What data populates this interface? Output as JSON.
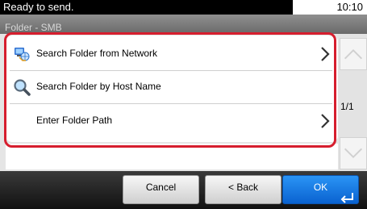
{
  "status": {
    "message": "Ready to send.",
    "time": "10:10"
  },
  "screen": {
    "title": "Folder - SMB"
  },
  "menu": {
    "items": [
      {
        "label": "Search Folder from Network",
        "icon": "network-folder-icon",
        "has_arrow": true
      },
      {
        "label": "Search Folder by Host Name",
        "icon": "magnifier-icon",
        "has_arrow": false
      },
      {
        "label": "Enter Folder Path",
        "icon": "",
        "has_arrow": true
      }
    ]
  },
  "pagination": {
    "page": "1/1"
  },
  "footer": {
    "cancel_label": "Cancel",
    "back_label": "< Back",
    "ok_label": "OK"
  },
  "colors": {
    "highlight_frame": "#d61e2e",
    "ok_button": "#1a7ce6"
  }
}
